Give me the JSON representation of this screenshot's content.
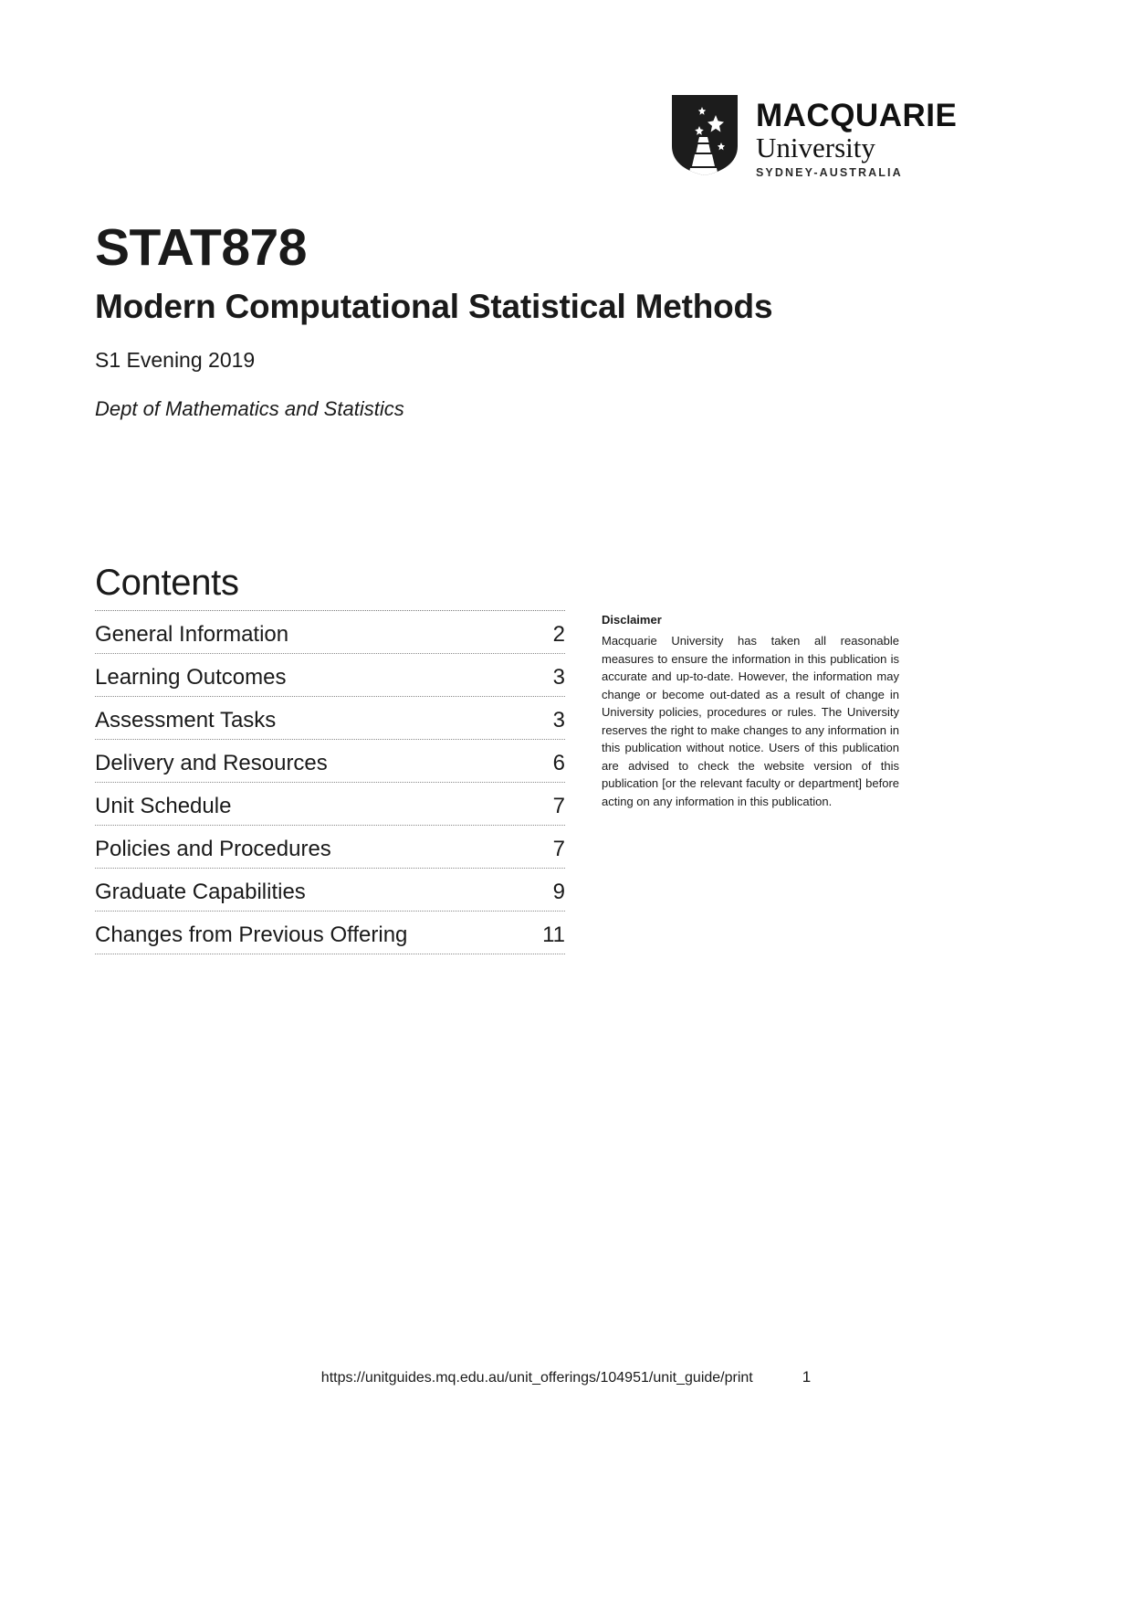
{
  "logo": {
    "icon": "macquarie-shield-icon",
    "line1": "MACQUARIE",
    "line2": "University",
    "line3": "SYDNEY-AUSTRALIA"
  },
  "unit": {
    "code": "STAT878",
    "name": "Modern Computational Statistical Methods",
    "session": "S1 Evening 2019",
    "department": "Dept of Mathematics and Statistics"
  },
  "contents": {
    "heading": "Contents",
    "entries": [
      {
        "label": "General Information",
        "page": "2"
      },
      {
        "label": "Learning Outcomes",
        "page": "3"
      },
      {
        "label": "Assessment Tasks",
        "page": "3"
      },
      {
        "label": "Delivery and Resources",
        "page": "6"
      },
      {
        "label": "Unit Schedule",
        "page": "7"
      },
      {
        "label": "Policies and Procedures",
        "page": "7"
      },
      {
        "label": "Graduate Capabilities",
        "page": "9"
      },
      {
        "label": "Changes from Previous Offering",
        "page": "11"
      }
    ]
  },
  "disclaimer": {
    "title": "Disclaimer",
    "body": "Macquarie University has taken all reasonable measures to ensure the information in this publication is accurate and up-to-date. However, the information may change or become out-dated as a result of change in University policies, procedures or rules. The University reserves the right to make changes to any information in this publication without notice. Users of this publication are advised to check the website version of this publication [or the relevant faculty or department] before acting on any information in this publication."
  },
  "footer": {
    "url": "https://unitguides.mq.edu.au/unit_offerings/104951/unit_guide/print",
    "page_number": "1"
  }
}
